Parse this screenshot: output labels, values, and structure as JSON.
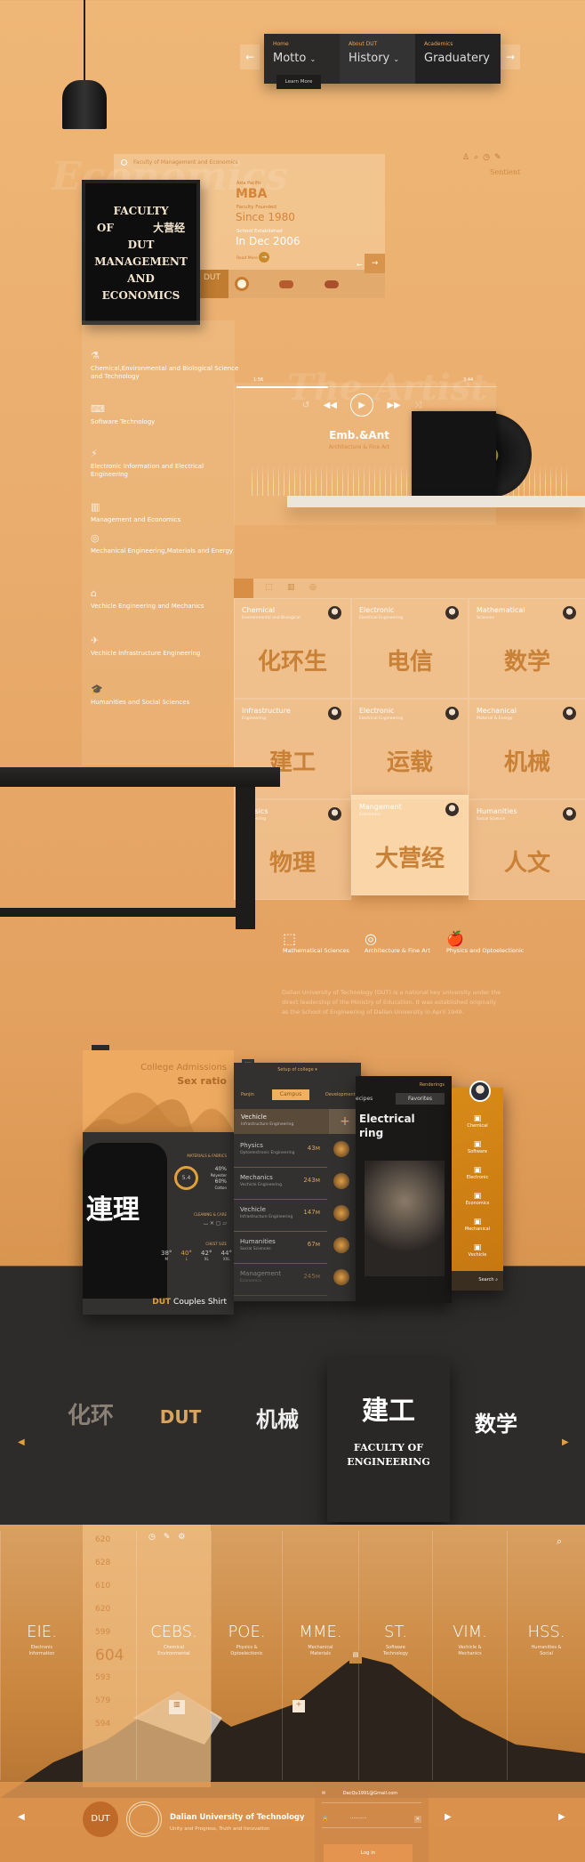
{
  "nav": {
    "prev": "←",
    "next": "→",
    "items": [
      {
        "kicker": "Home",
        "label": "Motto"
      },
      {
        "kicker": "About DUT",
        "label": "History"
      },
      {
        "kicker": "Academics",
        "label": "Graduatery"
      }
    ],
    "tooltip": "Learn More"
  },
  "top_right": {
    "label": "Sentient",
    "icons": [
      "user-icon",
      "search-icon",
      "clock-icon",
      "edit-icon"
    ]
  },
  "feature": {
    "watermark": "Economics",
    "header": "Faculty of Management and Economics",
    "kicker": "Asia Pacific",
    "title": "MBA",
    "founded_label": "Faculty Founded",
    "founded": "Since 1980",
    "established_label": "School Established",
    "established": "In Dec 2006",
    "read_more": "Read More",
    "strip_label": "DUT"
  },
  "poster": {
    "text": "FACULTY OF 大营经 DUT MANAGEMENT AND ECONOMICS"
  },
  "faculties": [
    "Chemical,Environmental and Biological Science and Technology",
    "Software Technology",
    "Electronic Information and Electrical Engineering",
    "Management and Economics",
    "Mechanical Engineering,Materials and Energy",
    "Vechicle Engineering and Mechanics",
    "Vechicle Infrastructure Engineering",
    "Humanities and Social Sciences"
  ],
  "player": {
    "watermark": "The Artist",
    "elapsed": "1:56",
    "total": "3:44",
    "progress": 0.35,
    "title": "Emb.&Ant",
    "subtitle": "Architecture & Fine Art"
  },
  "grid": {
    "cards": [
      {
        "title": "Chemical",
        "subtitle": "Environmental and Biological",
        "glyph": "化环生"
      },
      {
        "title": "Electronic",
        "subtitle": "Electrical Engineering",
        "glyph": "电信"
      },
      {
        "title": "Mathematical",
        "subtitle": "Sciences",
        "glyph": "数学"
      },
      {
        "title": "Infrastructure",
        "subtitle": "Engineering",
        "glyph": "建工"
      },
      {
        "title": "Electronic",
        "subtitle": "Electrical Engineering",
        "glyph": "运载"
      },
      {
        "title": "Mechanical",
        "subtitle": "Material & Energy",
        "glyph": "机械"
      },
      {
        "title": "Physics",
        "subtitle": "Engineering",
        "glyph": "物理"
      },
      {
        "title": "Mangement",
        "subtitle": "Economics",
        "glyph": "大营经"
      },
      {
        "title": "Humanities",
        "subtitle": "Social Science",
        "glyph": "人文"
      }
    ]
  },
  "disciplines": [
    "Mathematical Sciences",
    "Architecture & Fine Art",
    "Physics and Optoelectionic"
  ],
  "about": "Dalian University of Techoology (DUT) is a national key university under the direct leadership of the Ministry of Education. It was established originally as the School of Engineering of Dalian University in April 1949.",
  "admissions": {
    "title1": "College Admissions",
    "title2": "Sex ratio"
  },
  "shirt": {
    "materials": "MATERIALS & FABRICS",
    "ring": "5.4",
    "p1": "40%",
    "p1l": "Polyester",
    "p2": "60%",
    "p2l": "Cotton",
    "care": "CLEANING & CARE",
    "chest": "CHEST SIZE",
    "sizes": [
      {
        "v": "38°",
        "s": "M"
      },
      {
        "v": "40°",
        "s": "L"
      },
      {
        "v": "42°",
        "s": "XL"
      },
      {
        "v": "44°",
        "s": "XXL"
      }
    ],
    "brand": "DUT",
    "name": "Couples Shirt"
  },
  "college_app": {
    "dropdown": "Setup of college",
    "tabs": [
      "Panjin",
      "Campus",
      "Development"
    ],
    "active": {
      "title": "Vechicle",
      "sub": "Infrastructure Engineering"
    },
    "rows": [
      {
        "title": "Physics",
        "sub": "Optoelectronic Engineering",
        "v": "43м"
      },
      {
        "title": "Mechanics",
        "sub": "Vechicle Engineering",
        "v": "243м"
      },
      {
        "title": "Vechicle",
        "sub": "Infrastructure Engineering",
        "v": "147м"
      },
      {
        "title": "Humanities",
        "sub": "Social Sciences",
        "v": "67м"
      },
      {
        "title": "Management",
        "sub": "Economics",
        "v": "245м"
      }
    ]
  },
  "render_app": {
    "tab": "Renderings",
    "tab1": "ecipes",
    "tab2": "Favorites",
    "title": "Electrical",
    "title2": "ring"
  },
  "side_app": {
    "items": [
      "Chemical",
      "Software",
      "Electronic",
      "Economics",
      "Mechanical",
      "Vechicle"
    ],
    "search": "Search"
  },
  "carousel": {
    "featured": "FACULTY OF ENGINEERING",
    "glyphs": [
      "化环",
      "DUT",
      "机械",
      "建工",
      "数学"
    ]
  },
  "scores": [
    "620",
    "628",
    "610",
    "620",
    "599",
    "604",
    "593",
    "579",
    "594"
  ],
  "colleges": [
    {
      "abbr": "EIE.",
      "desc": "Electronic Information"
    },
    {
      "abbr": "CEBS.",
      "desc": "Chemical Environmental"
    },
    {
      "abbr": "POE.",
      "desc": "Physics & Optoelectionic"
    },
    {
      "abbr": "MME.",
      "desc": "Mechanical Materials"
    },
    {
      "abbr": "ST.",
      "desc": "Software Technology"
    },
    {
      "abbr": "VIM.",
      "desc": "Vechicle & Mechanics"
    },
    {
      "abbr": "HSS.",
      "desc": "Humanities & Social"
    }
  ],
  "footer": {
    "badge": "DUT",
    "name": "Dalian University of Technology",
    "motto": "Unity and Progress, Truth and Innovation",
    "email": "DacQu1991@Gmail.com",
    "password": "··········",
    "login": "Log in"
  },
  "colors": {
    "accent": "#e8a968",
    "dark": "#2b2a29",
    "gold": "#d8a460"
  }
}
